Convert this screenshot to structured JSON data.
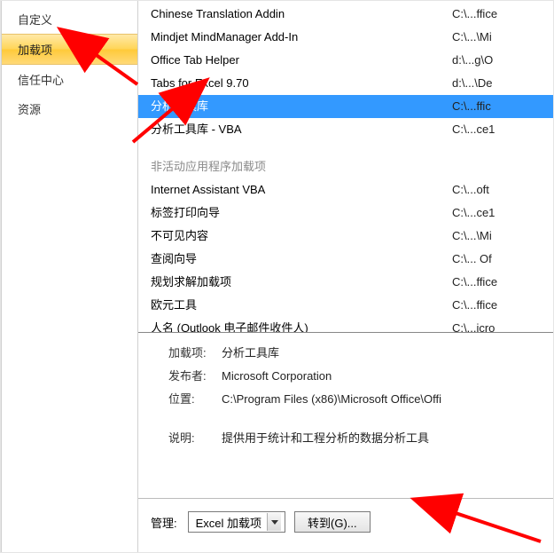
{
  "sidebar": {
    "items": [
      {
        "label": "自定义",
        "selected": false
      },
      {
        "label": "加载项",
        "selected": true
      },
      {
        "label": "信任中心",
        "selected": false
      },
      {
        "label": "资源",
        "selected": false
      }
    ]
  },
  "addins": {
    "active_rows": [
      {
        "name": "Chinese Translation Addin",
        "path": "C:\\...ffice"
      },
      {
        "name": "Mindjet MindManager Add-In",
        "path": "C:\\...\\Mi"
      },
      {
        "name": "Office Tab Helper",
        "path": "d:\\...g\\O"
      },
      {
        "name": "Tabs for Excel 9.70",
        "path": "d:\\...\\De"
      },
      {
        "name": "分析工具库",
        "path": "C:\\...ffic",
        "selected": true
      },
      {
        "name": "分析工具库 - VBA",
        "path": "C:\\...ce1"
      }
    ],
    "inactive_header": "非活动应用程序加载项",
    "inactive_rows": [
      {
        "name": "Internet Assistant VBA",
        "path": "C:\\...oft "
      },
      {
        "name": "标签打印向导",
        "path": "C:\\...ce1"
      },
      {
        "name": "不可见内容",
        "path": "C:\\...\\Mi"
      },
      {
        "name": "查阅向导",
        "path": "C:\\... Of"
      },
      {
        "name": "规划求解加载项",
        "path": "C:\\...ffice"
      },
      {
        "name": "欧元工具",
        "path": "C:\\...ffice"
      },
      {
        "name": "人名 (Outlook 电子邮件收件人)",
        "path": "C:\\...icro"
      }
    ]
  },
  "details": {
    "labels": {
      "addin": "加载项:",
      "publisher": "发布者:",
      "location": "位置:",
      "description": "说明:"
    },
    "addin": "分析工具库",
    "publisher": "Microsoft Corporation",
    "location": "C:\\Program Files (x86)\\Microsoft Office\\Offi",
    "description": "提供用于统计和工程分析的数据分析工具"
  },
  "bottom": {
    "manage_label": "管理:",
    "dropdown_value": "Excel 加载项",
    "go_button": "转到(G)..."
  }
}
